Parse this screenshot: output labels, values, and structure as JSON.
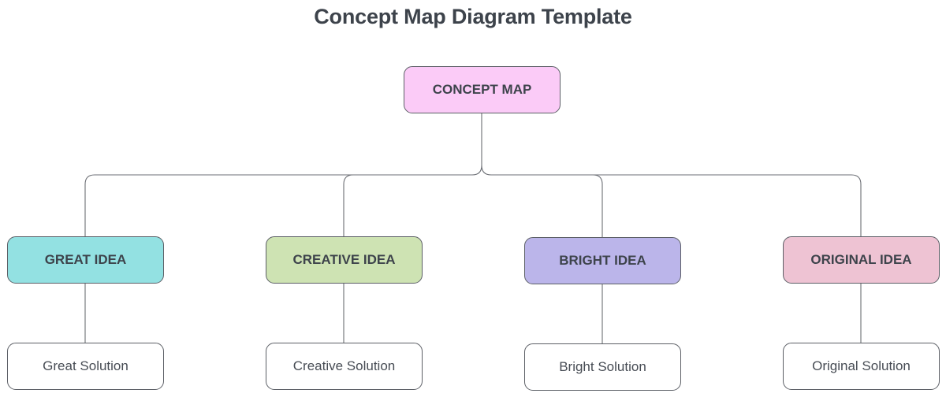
{
  "title": "Concept Map Diagram Template",
  "root": {
    "label": "CONCEPT MAP",
    "color": "#fbcbf7"
  },
  "ideas": [
    {
      "label": "GREAT IDEA",
      "color": "#93e1e2",
      "solution": "Great Solution"
    },
    {
      "label": "CREATIVE IDEA",
      "color": "#cee3b3",
      "solution": "Creative Solution"
    },
    {
      "label": "BRIGHT IDEA",
      "color": "#bbb5ea",
      "solution": "Bright Solution"
    },
    {
      "label": "ORIGINAL IDEA",
      "color": "#eec3d3",
      "solution": "Original Solution"
    }
  ],
  "colors": {
    "text": "#3d434b",
    "border": "#5c5f66",
    "connector": "#6b6e74"
  }
}
